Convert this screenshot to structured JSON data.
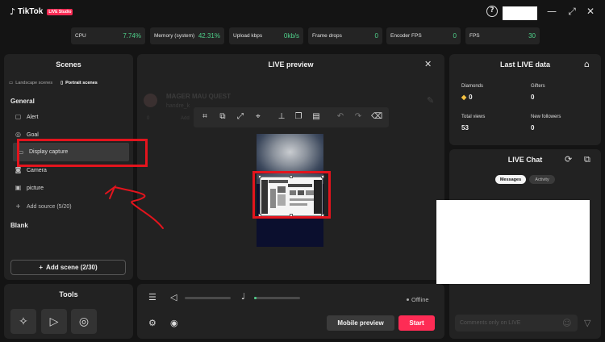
{
  "app": {
    "logo_mark": "♪",
    "name": "TikTok",
    "badge": "LIVE Studio"
  },
  "titlebar": {
    "help": "?",
    "minimize": "—",
    "maximize": "⤢",
    "close": "✕"
  },
  "stats": [
    {
      "label": "CPU",
      "value": "7.74%"
    },
    {
      "label": "Memory (system)",
      "value": "42.31%"
    },
    {
      "label": "Upload kbps",
      "value": "0kb/s"
    },
    {
      "label": "Frame drops",
      "value": "0"
    },
    {
      "label": "Encoder FPS",
      "value": "0"
    },
    {
      "label": "FPS",
      "value": "30"
    }
  ],
  "scenes": {
    "title": "Scenes",
    "tabs": [
      {
        "label": "Landscape scenes",
        "icon": "landscape-icon"
      },
      {
        "label": "Portrait scenes",
        "icon": "portrait-icon"
      }
    ],
    "general_label": "General",
    "sources": [
      {
        "label": "Alert",
        "icon": "alert-icon"
      },
      {
        "label": "Goal",
        "icon": "goal-icon"
      },
      {
        "label": "Display capture",
        "icon": "monitor-icon"
      },
      {
        "label": "Camera",
        "icon": "camera-icon"
      },
      {
        "label": "picture",
        "icon": "image-icon"
      }
    ],
    "add_source": "Add source (5/20)",
    "blank_label": "Blank",
    "add_scene": "Add scene (2/30)"
  },
  "tools": {
    "title": "Tools"
  },
  "preview": {
    "title": "LIVE preview",
    "ghost_title": "MAGER MAU QUEST",
    "ghost_user": "handre_k",
    "ghost_likes": "0",
    "ghost_add": "Add"
  },
  "controls": {
    "offline": "Offline",
    "mobile_preview": "Mobile preview",
    "start": "Start",
    "mic_level": 0.05
  },
  "last_live": {
    "title": "Last LIVE data",
    "diamonds_label": "Diamonds",
    "diamonds": "0",
    "gifters_label": "Gifters",
    "gifters": "0",
    "views_label": "Total views",
    "views": "53",
    "followers_label": "New followers",
    "followers": "0"
  },
  "chat": {
    "title": "LIVE Chat",
    "tabs": [
      "Messages",
      "Activity"
    ],
    "input_placeholder": "Comments only on LIVE"
  },
  "colors": {
    "accent": "#fe2c55",
    "positive": "#4fd08a",
    "annotation": "#e3141d"
  }
}
